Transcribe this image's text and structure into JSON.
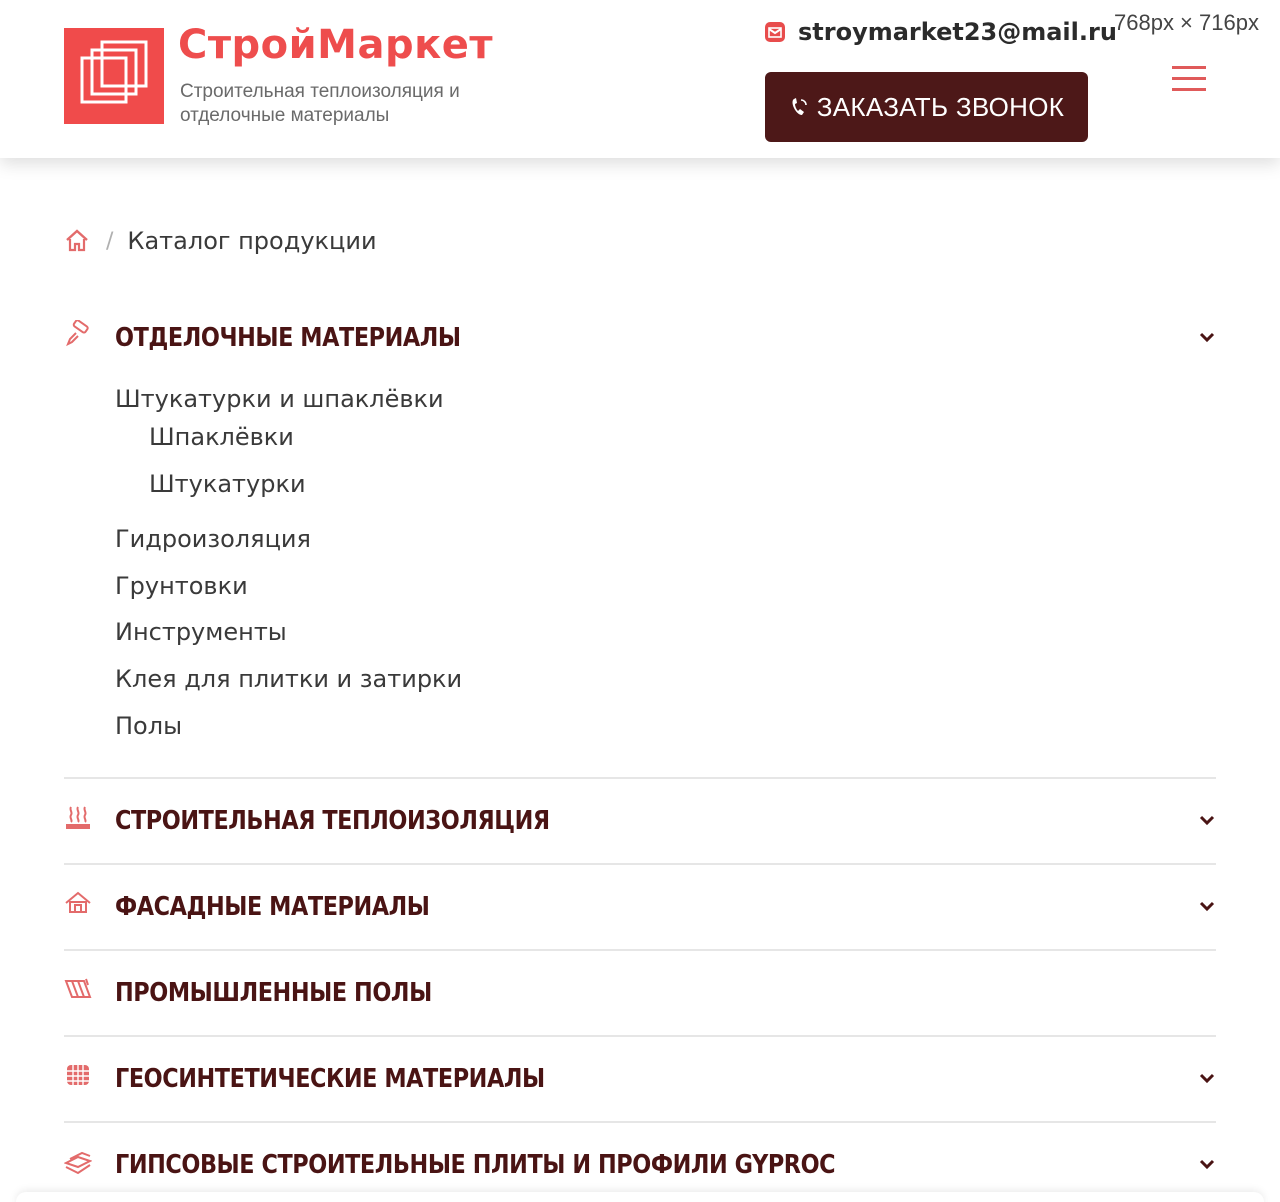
{
  "header": {
    "brand_name": "СтройМаркет",
    "brand_tagline": "Строительная теплоизоляция и отделочные материалы",
    "email": "stroymarket23@mail.ru",
    "call_button_label": "ЗАКАЗАТЬ ЗВОНОК",
    "viewport_size_label": "768px × 716px"
  },
  "breadcrumb": {
    "separator": "/",
    "current": "Каталог продукции"
  },
  "catalog": {
    "expanded": {
      "title": "ОТДЕЛОЧНЫЕ МАТЕРИАЛЫ",
      "group": {
        "label": "Штукатурки и шпаклёвки",
        "children": [
          "Шпаклёвки",
          "Штукатурки"
        ]
      },
      "items": [
        "Гидроизоляция",
        "Грунтовки",
        "Инструменты",
        "Клея для плитки и затирки",
        "Полы"
      ]
    },
    "categories": [
      {
        "title": "СТРОИТЕЛЬНАЯ ТЕПЛОИЗОЛЯЦИЯ",
        "icon": "heat-icon",
        "has_chevron": true
      },
      {
        "title": "ФАСАДНЫЕ МАТЕРИАЛЫ",
        "icon": "facade-house-icon",
        "has_chevron": true
      },
      {
        "title": "ПРОМЫШЛЕННЫЕ ПОЛЫ",
        "icon": "floor-tiles-icon",
        "has_chevron": false
      },
      {
        "title": "ГЕОСИНТЕТИЧЕСКИЕ МАТЕРИАЛЫ",
        "icon": "geogrid-icon",
        "has_chevron": true
      },
      {
        "title": "ГИПСОВЫЕ СТРОИТЕЛЬНЫЕ ПЛИТЫ И ПРОФИЛИ GYPROC",
        "icon": "drywall-sheets-icon",
        "has_chevron": true
      }
    ]
  },
  "colors": {
    "brand_red": "#ee4d4d",
    "dark_maroon": "#4d1818",
    "category_text": "#4a1414",
    "icon_red": "#e36b6b"
  }
}
